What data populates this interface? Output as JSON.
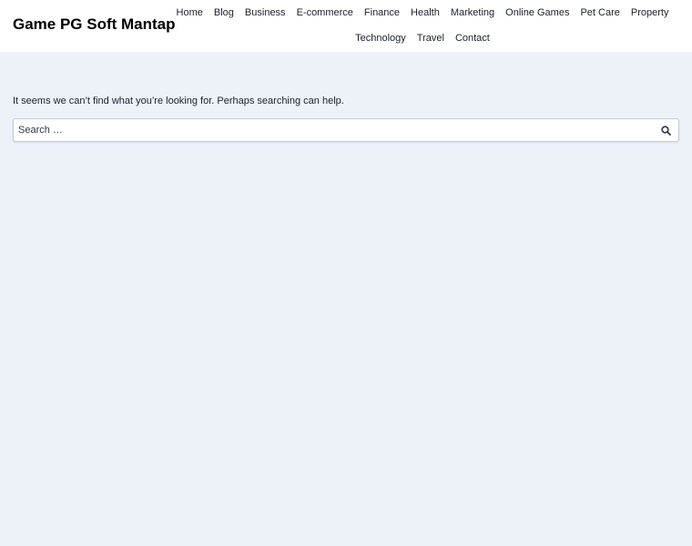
{
  "site": {
    "title": "Game PG Soft Mantap"
  },
  "nav": {
    "row1": [
      "Home",
      "Blog",
      "Business",
      "E-commerce",
      "Finance",
      "Health",
      "Marketing",
      "Online Games",
      "Pet Care",
      "Property"
    ],
    "row2": [
      "Technology",
      "Travel",
      "Contact"
    ]
  },
  "main": {
    "message": "It seems we can’t find what you’re looking for. Perhaps searching can help.",
    "search": {
      "placeholder": "Search …",
      "icon": "search-icon"
    }
  },
  "colors": {
    "page_background": "#edf2f9",
    "header_background": "#ffffff",
    "text": "#1a202c"
  }
}
